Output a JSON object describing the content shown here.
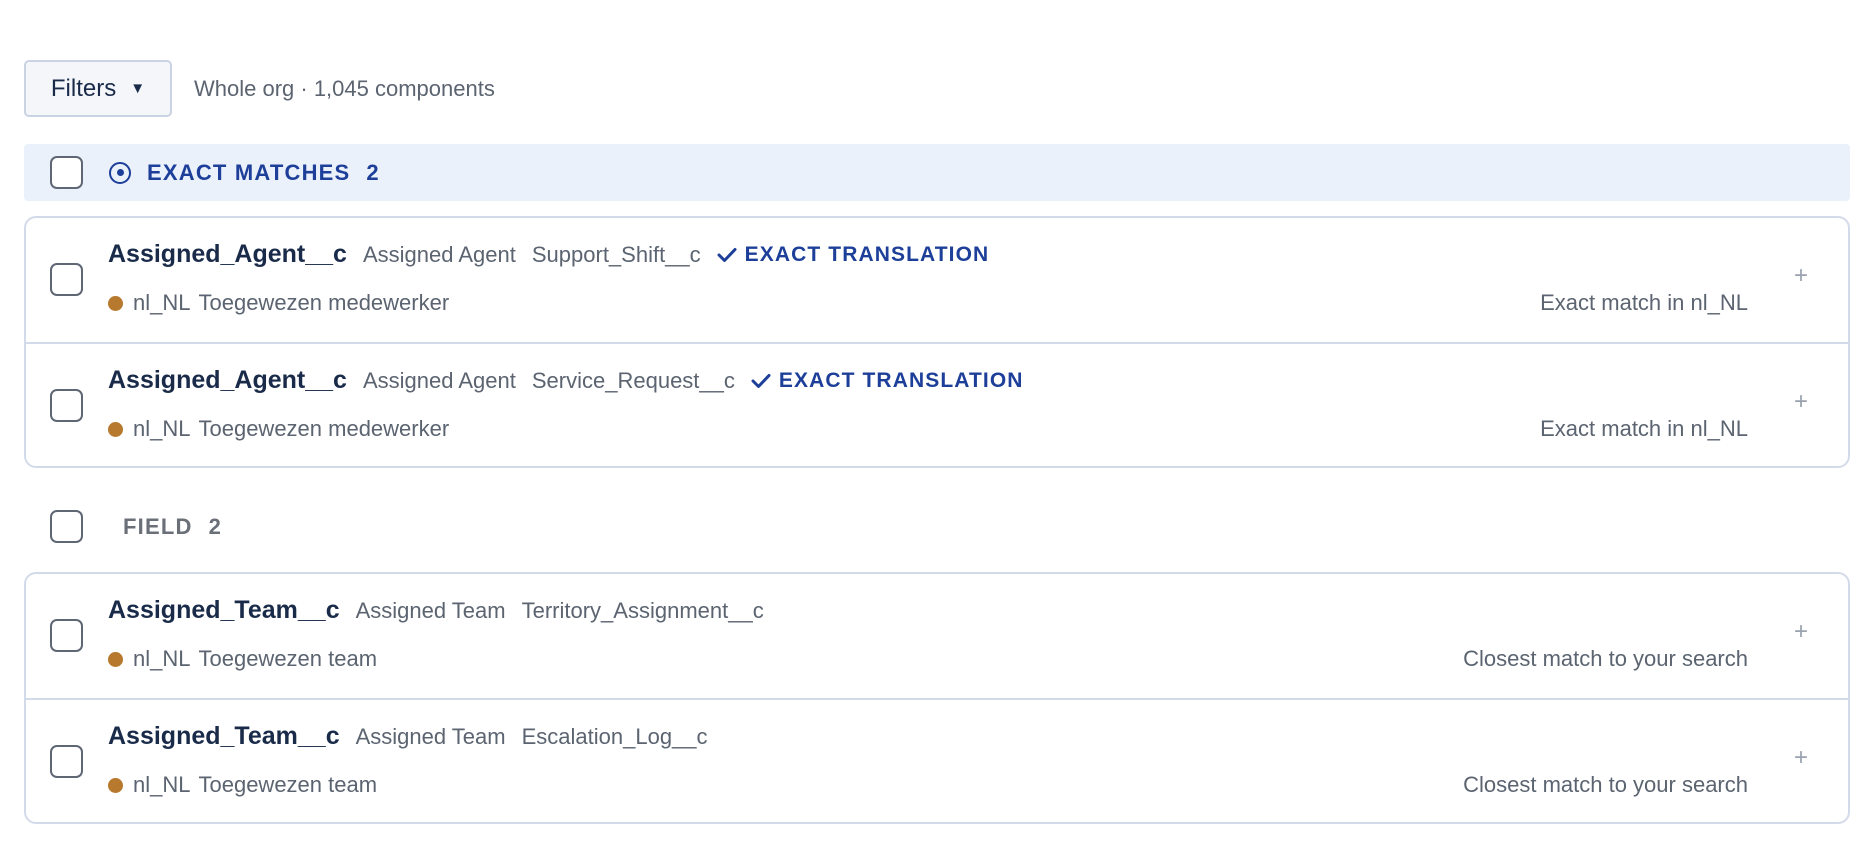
{
  "toolbar": {
    "filters_label": "Filters",
    "scope": "Whole org · 1,045 components"
  },
  "colors": {
    "accent": "#1d3f99",
    "dot": "#b7792d",
    "group_bg": "#ebf1fb",
    "border": "#d3daea"
  },
  "groups": [
    {
      "title": "EXACT MATCHES",
      "count": "2",
      "icon": "target-icon",
      "rows": [
        {
          "api_name": "Assigned_Agent__c",
          "label": "Assigned Agent",
          "object": "Support_Shift__c",
          "badge": "EXACT TRANSLATION",
          "locale": "nl_NL",
          "translation": "Toegewezen medewerker",
          "reason": "Exact match in nl_NL"
        },
        {
          "api_name": "Assigned_Agent__c",
          "label": "Assigned Agent",
          "object": "Service_Request__c",
          "badge": "EXACT TRANSLATION",
          "locale": "nl_NL",
          "translation": "Toegewezen medewerker",
          "reason": "Exact match in nl_NL"
        }
      ]
    },
    {
      "title": "FIELD",
      "count": "2",
      "rows": [
        {
          "api_name": "Assigned_Team__c",
          "label": "Assigned Team",
          "object": "Territory_Assignment__c",
          "locale": "nl_NL",
          "translation": "Toegewezen team",
          "reason": "Closest match to your search"
        },
        {
          "api_name": "Assigned_Team__c",
          "label": "Assigned Team",
          "object": "Escalation_Log__c",
          "locale": "nl_NL",
          "translation": "Toegewezen team",
          "reason": "Closest match to your search"
        }
      ]
    }
  ],
  "row_action": "+"
}
